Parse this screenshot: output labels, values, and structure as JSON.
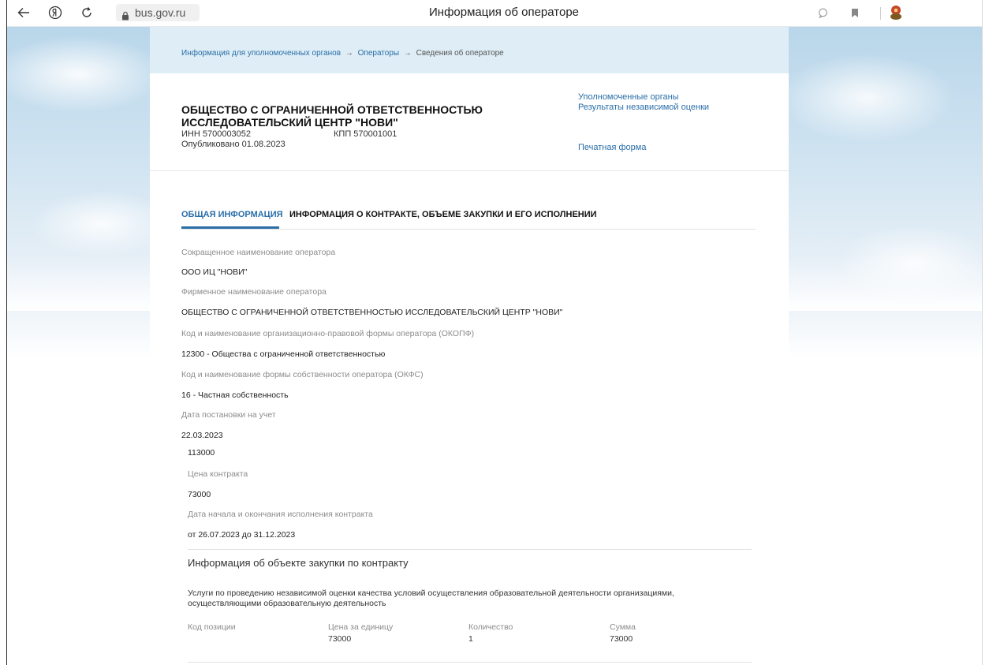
{
  "browser": {
    "url": "bus.gov.ru",
    "tab_title": "Информация об операторе"
  },
  "breadcrumb": {
    "items": [
      "Информация для уполномоченных органов",
      "Операторы",
      "Сведения об операторе"
    ],
    "separator": "→"
  },
  "header": {
    "org_name": "ОБЩЕСТВО С ОГРАНИЧЕННОЙ ОТВЕТСТВЕННОСТЬЮ ИССЛЕДОВАТЕЛЬСКИЙ ЦЕНТР \"НОВИ\"",
    "inn": "ИНН 5700003052",
    "kpp": "КПП 570001001",
    "published": "Опубликовано 01.08.2023",
    "links": {
      "authorities": "Уполномоченные органы",
      "results": "Результаты независимой оценки",
      "print": "Печатная форма"
    }
  },
  "tabs": [
    {
      "label": "ОБЩАЯ ИНФОРМАЦИЯ",
      "active": true
    },
    {
      "label": "ИНФОРМАЦИЯ О КОНТРАКТЕ, ОБЪЕМЕ ЗАКУПКИ И ЕГО ИСПОЛНЕНИИ",
      "active": false
    }
  ],
  "fields": [
    {
      "label": "Сокращенное наименование оператора",
      "value": "ООО ИЦ \"НОВИ\""
    },
    {
      "label": "Фирменное наименование оператора",
      "value": "ОБЩЕСТВО С ОГРАНИЧЕННОЙ ОТВЕТСТВЕННОСТЬЮ ИССЛЕДОВАТЕЛЬСКИЙ ЦЕНТР \"НОВИ\""
    },
    {
      "label": "Код и наименование организационно-правовой формы оператора (ОКОПФ)",
      "value": "12300 - Общества с ограниченной ответственностью"
    },
    {
      "label": "Код и наименование формы собственности оператора (ОКФС)",
      "value": "16 - Частная собственность"
    },
    {
      "label": "Дата постановки на учет",
      "value": "22.03.2023"
    }
  ],
  "contract": {
    "amount_top": "113000",
    "price_label": "Цена контракта",
    "price_value": "73000",
    "dates_label": "Дата начала и окончания исполнения контракта",
    "dates_value": "от 26.07.2023 до 31.12.2023"
  },
  "purchase": {
    "title": "Информация об объекте закупки по контракту",
    "description": "Услуги по проведению независимой оценки качества условий осуществления образовательной деятельности организациями, осуществляющими образовательную деятельность",
    "columns": [
      "Код позиции",
      "Цена за единицу",
      "Количество",
      "Сумма"
    ],
    "row": [
      "",
      "73000",
      "1",
      "73000"
    ]
  },
  "colors": {
    "link": "#2a6ea8",
    "breadcrumb_band": "#deedf6",
    "label_gray": "#8c8c8c"
  },
  "icons": [
    "back-arrow-icon",
    "yandex-logo-icon",
    "reload-icon",
    "lock-icon",
    "chat-bubble-icon",
    "bookmark-icon",
    "extension-icon"
  ]
}
